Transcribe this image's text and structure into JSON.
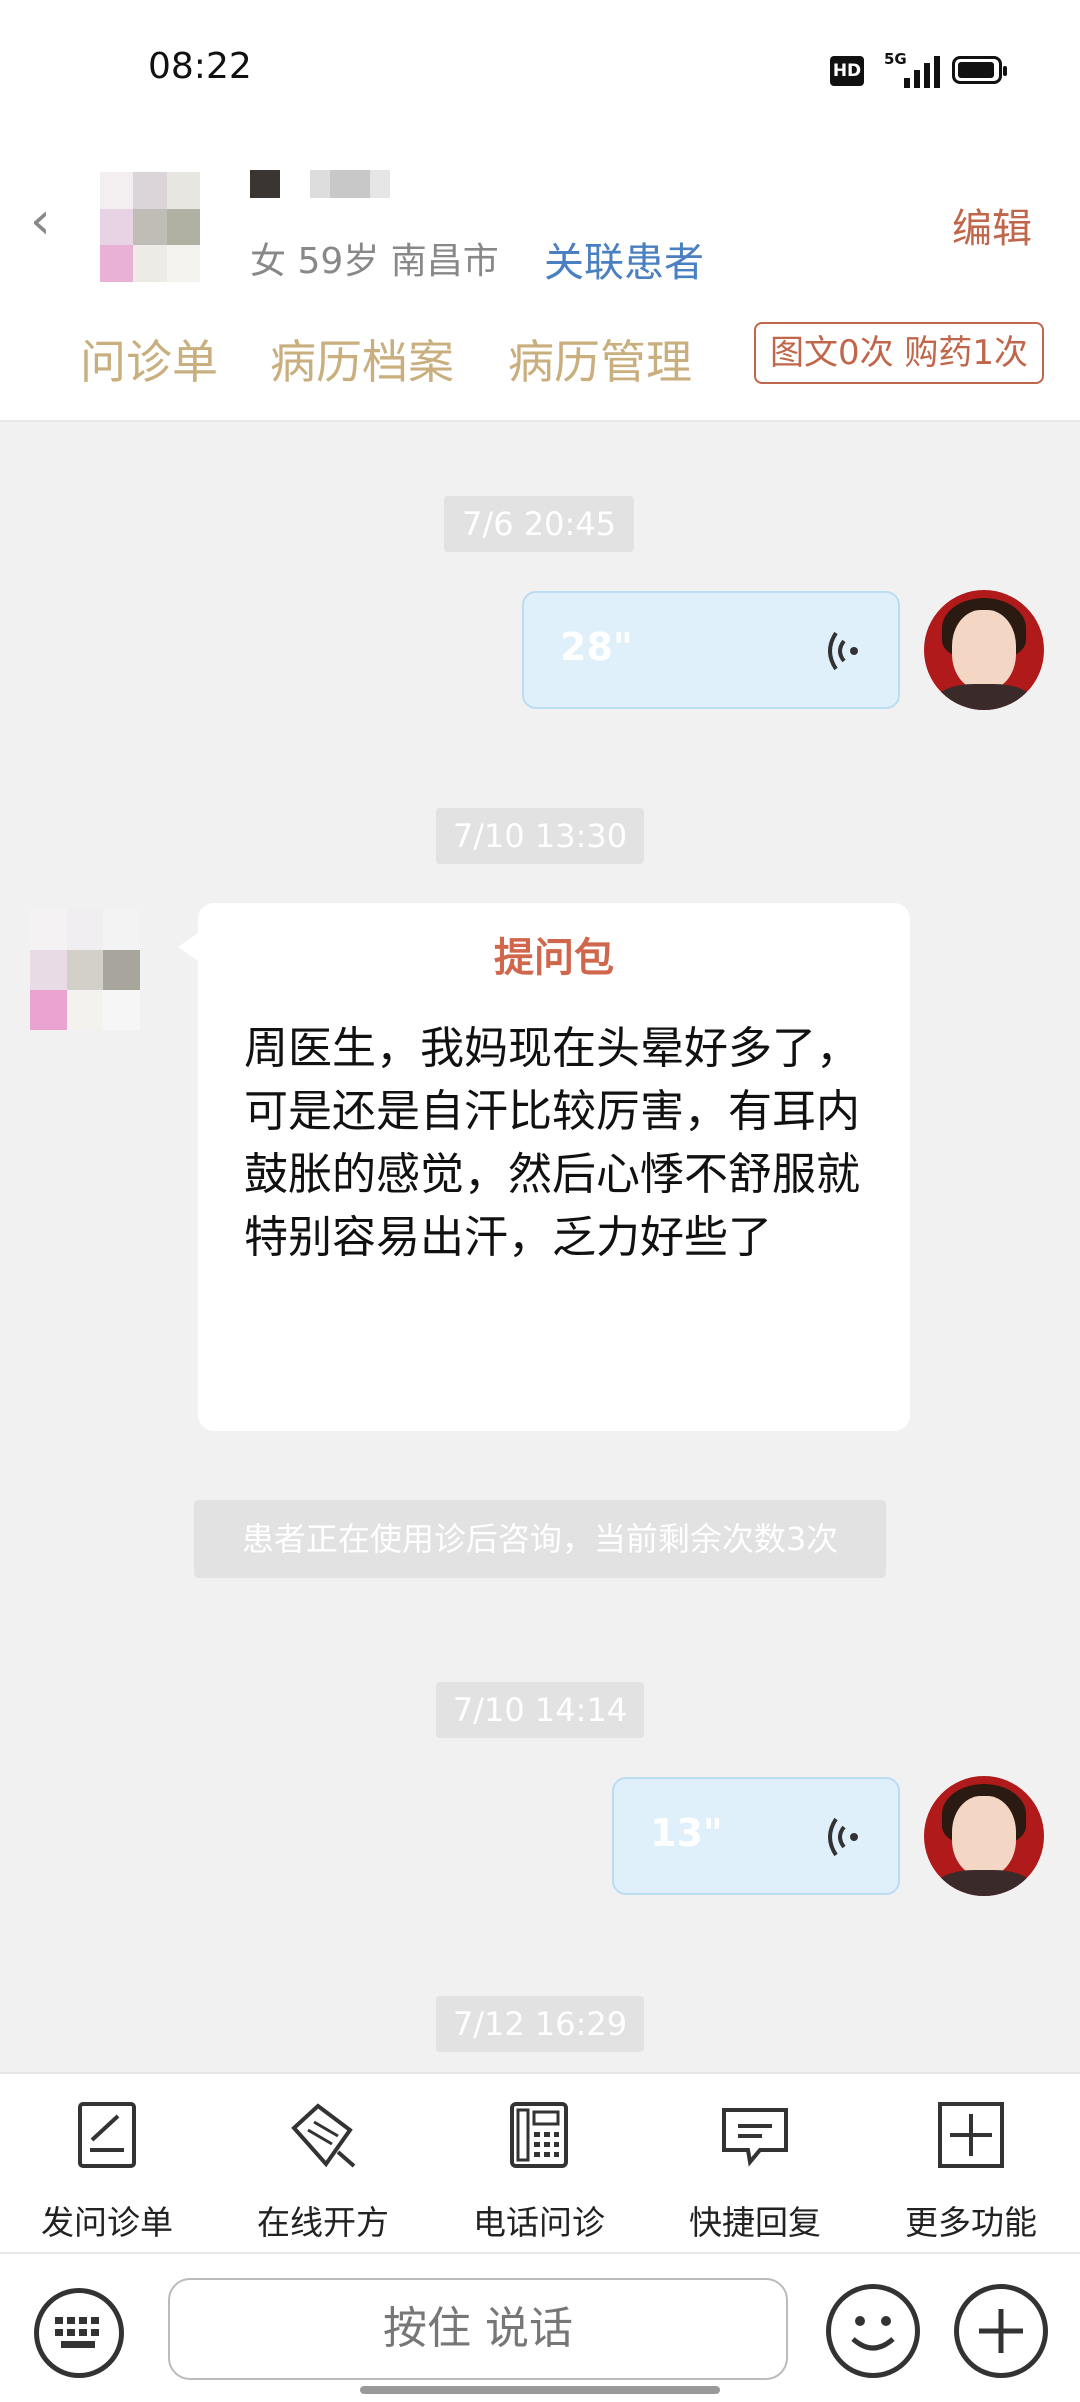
{
  "status_bar": {
    "time": "08:22",
    "hd": "HD",
    "network": "5G"
  },
  "header": {
    "back_icon": "back-arrow-icon",
    "patient_info": "女 59岁  南昌市",
    "link_patient": "关联患者",
    "edit": "编辑",
    "tabs": [
      "问诊单",
      "病历档案",
      "病历管理"
    ],
    "quota": "图文0次 购药1次"
  },
  "chat": {
    "messages": [
      {
        "time": "7/6 20:45",
        "voice_duration": "28\""
      },
      {
        "time": "7/10 13:30"
      },
      {
        "time": "7/10 14:14",
        "voice_duration": "13\""
      },
      {
        "time": "7/12 16:29"
      }
    ],
    "question_pack": {
      "title": "提问包",
      "text": "周医生，我妈现在头晕好多了，可是还是自汗比较厉害，有耳内鼓胀的感觉，然后心悸不舒服就特别容易出汗，乏力好些了"
    },
    "notice": "患者正在使用诊后咨询，当前剩余次数3次"
  },
  "toolbar": {
    "items": [
      {
        "label": "发问诊单",
        "icon": "form-edit-icon"
      },
      {
        "label": "在线开方",
        "icon": "prescription-pen-icon"
      },
      {
        "label": "电话问诊",
        "icon": "phone-keypad-icon"
      },
      {
        "label": "快捷回复",
        "icon": "chat-bubble-icon"
      },
      {
        "label": "更多功能",
        "icon": "plus-square-icon"
      }
    ]
  },
  "input": {
    "hold_to_talk": "按住 说话"
  },
  "colors": {
    "accent": "#c0664a",
    "tab": "#c9ae7e",
    "link": "#4a7fc1",
    "voice_bubble": "#dff0fb"
  }
}
